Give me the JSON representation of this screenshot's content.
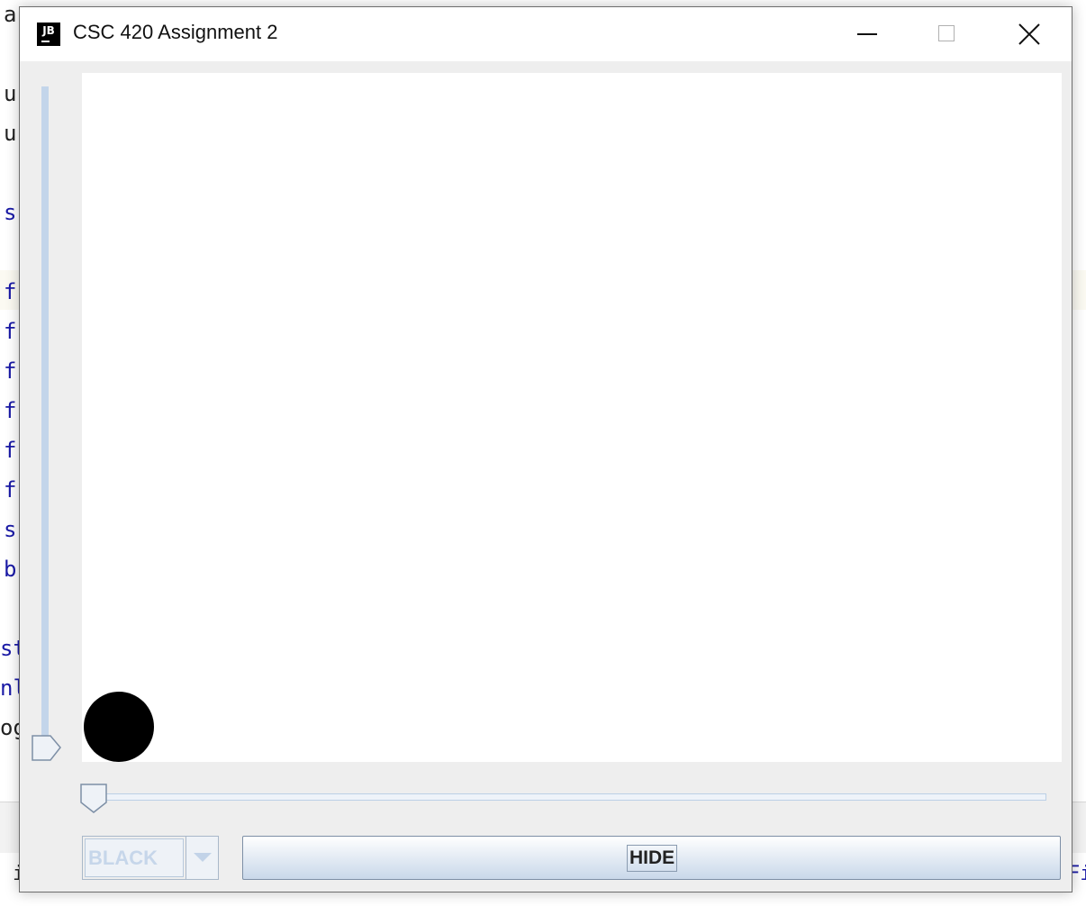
{
  "background_ide": {
    "left_chars": [
      "a",
      "u",
      "u",
      "s",
      "f",
      "f",
      "f",
      "f",
      "f",
      "f",
      "s",
      "b",
      "st",
      "nl",
      "og"
    ],
    "bottom_left": "i",
    "bottom_right": "Fi"
  },
  "window": {
    "title": "CSC 420 Assignment 2",
    "app_icon_text": "JB",
    "minimize_glyph": "—",
    "close_glyph": "✕"
  },
  "canvas": {
    "ball_color": "#000000",
    "background": "#ffffff"
  },
  "vertical_slider": {
    "value_fraction": 0.0
  },
  "horizontal_slider": {
    "value_fraction": 0.0
  },
  "color_combo": {
    "selected": "BLACK",
    "enabled": false
  },
  "hide_button": {
    "label": "HIDE"
  },
  "colors": {
    "slider_track": "#c3d5ea",
    "window_bg": "#eeeeee"
  }
}
